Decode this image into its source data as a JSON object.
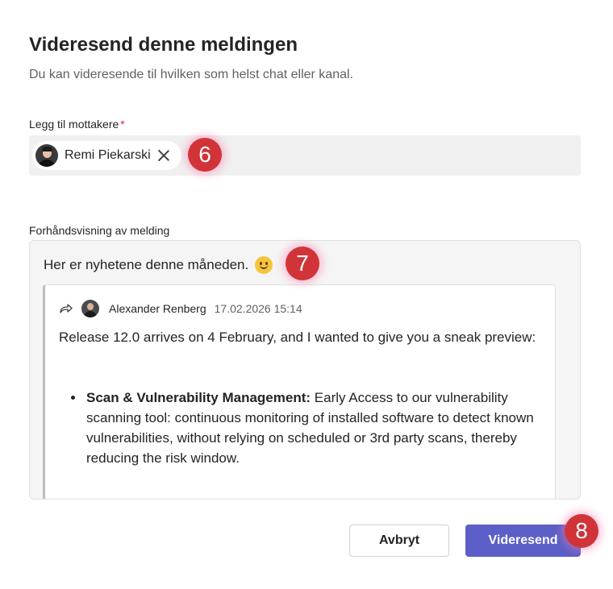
{
  "dialog": {
    "title": "Videresend denne meldingen",
    "subtitle": "Du kan videresende til hvilken som helst chat eller kanal."
  },
  "recipients": {
    "label": "Legg til mottakere",
    "required_mark": "*",
    "chips": [
      {
        "name": "Remi Piekarski",
        "remove_icon": "close-icon"
      }
    ]
  },
  "preview": {
    "label": "Forhåndsvisning av melding",
    "message": "Her er nyhetene denne måneden.",
    "emoji": "smile-emoji",
    "quoted": {
      "icon": "forward-icon",
      "author": "Alexander Renberg",
      "timestamp": "17.02.2026 15:14",
      "intro": "Release 12.0 arrives on 4 February, and I wanted to give you a sneak preview:",
      "bullets": [
        {
          "heading": "Scan & Vulnerability Management:",
          "text": " Early Access to our vulnerability scanning tool: continuous monitoring of installed software to detect known vulnerabilities, without relying on scheduled or 3rd party scans, thereby reducing the risk window."
        }
      ]
    }
  },
  "buttons": {
    "cancel": "Avbryt",
    "send": "Videresend"
  },
  "annotations": {
    "badge_6": "6",
    "badge_7": "7",
    "badge_8": "8",
    "badge_color": "#d13438"
  },
  "colors": {
    "accent": "#5b5fc7",
    "required": "#c4314b"
  }
}
